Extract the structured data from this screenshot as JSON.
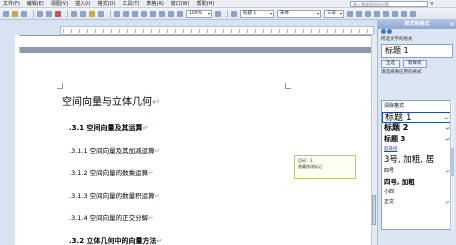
{
  "menubar": {
    "items": [
      "文件(F)",
      "编辑(E)",
      "视图(V)",
      "插入(I)",
      "格式(O)",
      "工具(T)",
      "表格(A)",
      "窗口(W)",
      "帮助(H)"
    ],
    "help_placeholder": "键入需要帮助的问题",
    "close_glyph": "×"
  },
  "toolbar": {
    "zoom": "100%",
    "style": "标题 1",
    "font": "宋体",
    "size": "三号",
    "combo_arrow": "▾"
  },
  "document": {
    "heading": "空间向量与立体几何",
    "lines": [
      {
        "text": ".3.1  空间向量及其运算",
        "level": "h2"
      },
      {
        "text": ".3.1.1  空间向量及其加减运算",
        "level": "h3"
      },
      {
        "text": ".3.1.2  空间向量的数乘运算",
        "level": "h3"
      },
      {
        "text": ".3.1.3  空间向量的数量积运算",
        "level": "h3"
      },
      {
        "text": ".3.1.4  空间向量的正交分解",
        "level": "h3"
      },
      {
        "text": ".3.2  立体几何中的向量方法",
        "level": "h2"
      }
    ],
    "pilcrow": "↵"
  },
  "balloon": {
    "line1": "页码：3",
    "line2": "隐藏修改标记"
  },
  "styles_pane": {
    "title": "样式和格式",
    "close_glyph": "×",
    "selected_label": "所选文字的格式",
    "current_style": "标题 1",
    "select_all_button": "全选",
    "new_style_button": "新样式",
    "apply_label": "请选择要应用的格式",
    "styles": [
      {
        "name": "清除格式",
        "class": "s-clear",
        "mark": ""
      },
      {
        "name": "标题 1",
        "class": "s-h1",
        "mark": "↵"
      },
      {
        "name": "标题 2",
        "class": "s-h2",
        "mark": "↵"
      },
      {
        "name": "标题 3",
        "class": "s-h3",
        "mark": "↵"
      },
      {
        "name": "超链接",
        "class": "s-hyper",
        "mark": ""
      },
      {
        "name": "3号, 加粗, 居",
        "class": "s-big",
        "mark": ""
      },
      {
        "name": "四号",
        "class": "s-small",
        "mark": "↵"
      },
      {
        "name": "四号, 加粗",
        "class": "s-bold",
        "mark": ""
      },
      {
        "name": "小四",
        "class": "s-small",
        "mark": ""
      },
      {
        "name": "正文",
        "class": "s-small",
        "mark": "↵"
      }
    ]
  }
}
